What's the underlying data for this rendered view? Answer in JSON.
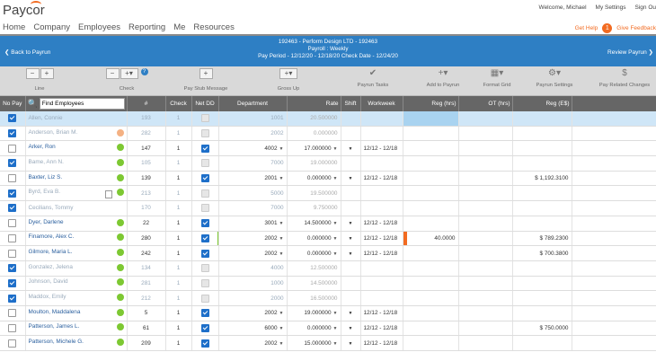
{
  "header": {
    "logo": "Paycor",
    "nav": [
      "Home",
      "Company",
      "Employees",
      "Reporting",
      "Me",
      "Resources"
    ],
    "welcome": "Welcome, Michael",
    "my_settings": "My Settings",
    "sign_out": "Sign Ou",
    "get_help": "Get Help",
    "help_count": "1",
    "give_feedback": "Give Feedback"
  },
  "payrun": {
    "back": "Back to Payrun",
    "line1": "192463 - Perform Design LTD - 192463",
    "line2": "Payroll : Weekly",
    "line3": "Pay Period - 12/12/20 - 12/18/20   Check Date - 12/24/20",
    "review": "Review Payrun"
  },
  "toolbar": {
    "line": "Line",
    "check": "Check",
    "pay_stub": "Pay Stub Message",
    "gross_up": "Gross Up",
    "payrun_tasks": "Payrun Tasks",
    "add_to_payrun": "Add to Payrun",
    "format_grid": "Format Grid",
    "payrun_settings": "Payrun Settings",
    "pay_related": "Pay Related Changes",
    "minus": "−",
    "plus": "+"
  },
  "table": {
    "headers": [
      "No Pay",
      "",
      "#",
      "Check",
      "Net DD",
      "Department",
      "Rate",
      "Shift",
      "Workweek",
      "Reg (hrs)",
      "OT (hrs)",
      "Reg (E$)"
    ],
    "search_placeholder": "Find Employees",
    "rows": [
      {
        "nopay": true,
        "name": "Allen, Connie",
        "dot": "",
        "num": "193",
        "check": "1",
        "netdd": "dis",
        "dept": "1001",
        "rate": "20.500000",
        "shift": "",
        "ww": "",
        "reg": "",
        "ot": "",
        "rege": "",
        "inactive": true,
        "hl": true
      },
      {
        "nopay": true,
        "name": "Anderson, Brian M.",
        "dot": "#f4b183",
        "num": "282",
        "check": "1",
        "netdd": "dis",
        "dept": "2002",
        "rate": "0.000000",
        "shift": "",
        "ww": "",
        "reg": "",
        "ot": "",
        "rege": "",
        "inactive": true
      },
      {
        "nopay": false,
        "name": "Arker, Ron",
        "dot": "#7dc832",
        "num": "147",
        "check": "1",
        "netdd": "on",
        "dept": "4002",
        "rate": "17.000000",
        "shift": "▼",
        "ww": "12/12 - 12/18",
        "reg": "",
        "ot": "",
        "rege": "",
        "arrows": true
      },
      {
        "nopay": true,
        "name": "Bame, Ann N.",
        "dot": "#7dc832",
        "num": "105",
        "check": "1",
        "netdd": "dis",
        "dept": "7000",
        "rate": "19.000000",
        "shift": "",
        "ww": "",
        "reg": "",
        "ot": "",
        "rege": "",
        "inactive": true
      },
      {
        "nopay": false,
        "name": "Baxter, Liz S.",
        "dot": "#7dc832",
        "num": "139",
        "check": "1",
        "netdd": "on",
        "dept": "2001",
        "rate": "0.000000",
        "shift": "▼",
        "ww": "12/12 - 12/18",
        "reg": "",
        "ot": "",
        "rege": "$ 1,192.3100",
        "arrows": true
      },
      {
        "nopay": true,
        "name": "Byrd, Eva B.",
        "dot": "#7dc832",
        "num": "213",
        "check": "1",
        "netdd": "dis",
        "dept": "5000",
        "rate": "19.500000",
        "shift": "",
        "ww": "",
        "reg": "",
        "ot": "",
        "rege": "",
        "inactive": true,
        "doc": true
      },
      {
        "nopay": true,
        "name": "Cecilians, Tommy",
        "dot": "",
        "num": "170",
        "check": "1",
        "netdd": "dis",
        "dept": "7000",
        "rate": "9.750000",
        "shift": "",
        "ww": "",
        "reg": "",
        "ot": "",
        "rege": "",
        "inactive": true
      },
      {
        "nopay": false,
        "name": "Dyer, Darlene",
        "dot": "#7dc832",
        "num": "22",
        "check": "1",
        "netdd": "on",
        "dept": "3001",
        "rate": "14.500000",
        "shift": "▼",
        "ww": "12/12 - 12/18",
        "reg": "",
        "ot": "",
        "rege": "",
        "arrows": true
      },
      {
        "nopay": false,
        "name": "Finamore, Alex C.",
        "dot": "#7dc832",
        "num": "280",
        "check": "1",
        "netdd": "on",
        "dept": "2002",
        "rate": "0.000000",
        "shift": "▼",
        "ww": "12/12 - 12/18",
        "reg": "40.0000",
        "ot": "",
        "rege": "$ 789.2300",
        "arrows": true,
        "flags": true
      },
      {
        "nopay": false,
        "name": "Gilmore, Maria L.",
        "dot": "#7dc832",
        "num": "242",
        "check": "1",
        "netdd": "on",
        "dept": "2002",
        "rate": "0.000000",
        "shift": "▼",
        "ww": "12/12 - 12/18",
        "reg": "",
        "ot": "",
        "rege": "$ 700.3800",
        "arrows": true,
        "dark": true
      },
      {
        "nopay": true,
        "name": "Gonzalez, Jelena",
        "dot": "#7dc832",
        "num": "134",
        "check": "1",
        "netdd": "dis",
        "dept": "4000",
        "rate": "12.500000",
        "shift": "",
        "ww": "",
        "reg": "",
        "ot": "",
        "rege": "",
        "inactive": true
      },
      {
        "nopay": true,
        "name": "Johnson, David",
        "dot": "#7dc832",
        "num": "281",
        "check": "1",
        "netdd": "dis",
        "dept": "1000",
        "rate": "14.500000",
        "shift": "",
        "ww": "",
        "reg": "",
        "ot": "",
        "rege": "",
        "inactive": true
      },
      {
        "nopay": true,
        "name": "Maddox, Emily",
        "dot": "#7dc832",
        "num": "212",
        "check": "1",
        "netdd": "dis",
        "dept": "2000",
        "rate": "16.500000",
        "shift": "",
        "ww": "",
        "reg": "",
        "ot": "",
        "rege": "",
        "inactive": true
      },
      {
        "nopay": false,
        "name": "Moulton, Maddalena",
        "dot": "#7dc832",
        "num": "5",
        "check": "1",
        "netdd": "on",
        "dept": "2002",
        "rate": "19.000000",
        "shift": "▼",
        "ww": "12/12 - 12/18",
        "reg": "",
        "ot": "",
        "rege": "",
        "arrows": true
      },
      {
        "nopay": false,
        "name": "Patterson, James L.",
        "dot": "#7dc832",
        "num": "61",
        "check": "1",
        "netdd": "on",
        "dept": "6000",
        "rate": "0.000000",
        "shift": "▼",
        "ww": "12/12 - 12/18",
        "reg": "",
        "ot": "",
        "rege": "$ 750.0000",
        "arrows": true
      },
      {
        "nopay": false,
        "name": "Patterson, Michele G.",
        "dot": "#7dc832",
        "num": "209",
        "check": "1",
        "netdd": "on",
        "dept": "2002",
        "rate": "15.000000",
        "shift": "▼",
        "ww": "12/12 - 12/18",
        "reg": "",
        "ot": "",
        "rege": "",
        "arrows": true
      }
    ]
  },
  "colors": {
    "brand_blue": "#2e7fc4",
    "accent_orange": "#f26b21",
    "status_green": "#7dc832",
    "header_gray": "#666666"
  }
}
